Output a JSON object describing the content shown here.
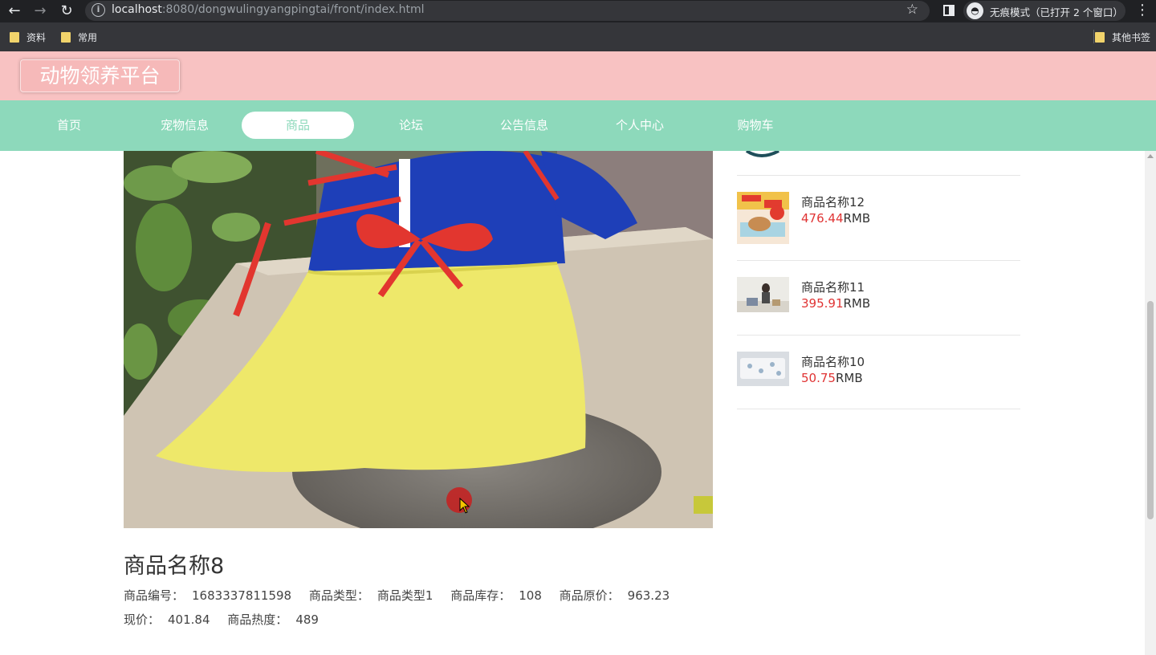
{
  "browser": {
    "url_host": "localhost",
    "url_rest": ":8080/dongwulingyangpingtai/front/index.html",
    "incognito_text": "无痕模式（已打开 2 个窗口）",
    "bookmarks": [
      "资料",
      "常用"
    ],
    "other_bookmarks": "其他书签"
  },
  "site": {
    "title": "动物领养平台",
    "nav": [
      "首页",
      "宠物信息",
      "商品",
      "论坛",
      "公告信息",
      "个人中心",
      "购物车"
    ],
    "active_nav": "商品"
  },
  "product": {
    "name": "商品名称8",
    "fields": [
      {
        "label": "商品编号：",
        "value": "1683337811598"
      },
      {
        "label": "商品类型：",
        "value": "商品类型1"
      },
      {
        "label": "商品库存：",
        "value": "108"
      },
      {
        "label": "商品原价：",
        "value": "963.23"
      }
    ],
    "fields2": [
      {
        "label": "现价：",
        "value": "401.84"
      },
      {
        "label": "商品热度：",
        "value": "489"
      }
    ]
  },
  "recommendations": [
    {
      "name": "商品名称12",
      "price": "476.44",
      "unit": "RMB"
    },
    {
      "name": "商品名称11",
      "price": "395.91",
      "unit": "RMB"
    },
    {
      "name": "商品名称10",
      "price": "50.75",
      "unit": "RMB"
    }
  ],
  "colors": {
    "header_bg": "#f8c2c2",
    "nav_bg": "#8dd9bb",
    "price_red": "#e03434"
  }
}
